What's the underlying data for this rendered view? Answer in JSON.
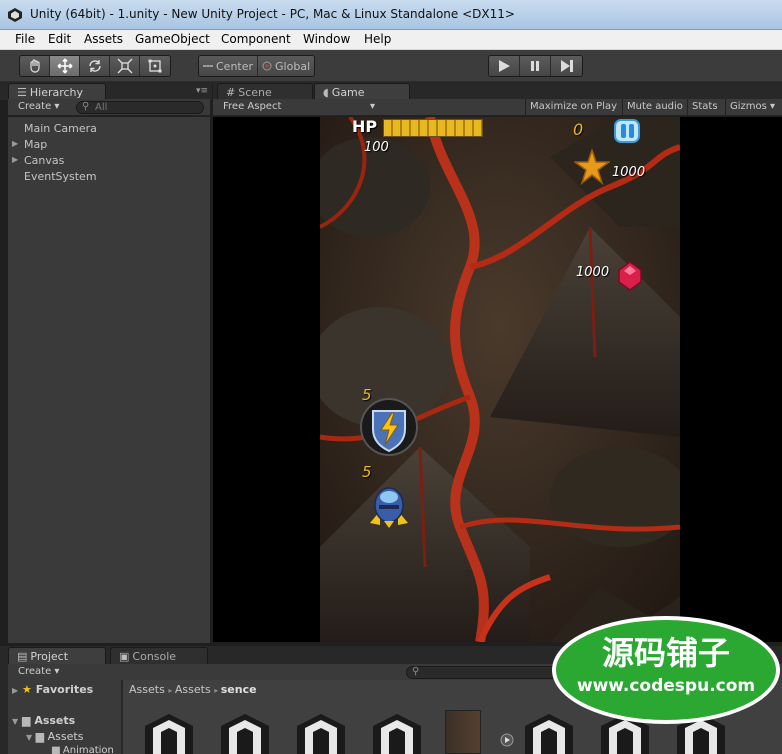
{
  "window": {
    "title": "Unity (64bit) - 1.unity - New Unity Project - PC, Mac & Linux Standalone <DX11>"
  },
  "menu": [
    "File",
    "Edit",
    "Assets",
    "GameObject",
    "Component",
    "Window",
    "Help"
  ],
  "toolbar": {
    "tools": [
      "hand-icon",
      "move-icon",
      "rotate-icon",
      "scale-icon",
      "rect-icon"
    ],
    "pivot_center": "Center",
    "pivot_global": "Global",
    "playback": [
      "play-icon",
      "pause-icon",
      "step-icon"
    ]
  },
  "hierarchy": {
    "tab_label": "Hierarchy",
    "create_label": "Create",
    "search_placeholder": "All",
    "items": [
      {
        "label": "Main Camera",
        "expandable": false
      },
      {
        "label": "Map",
        "expandable": true
      },
      {
        "label": "Canvas",
        "expandable": true
      },
      {
        "label": "EventSystem",
        "expandable": false
      }
    ]
  },
  "scene_tab": {
    "label": "Scene"
  },
  "game_tab": {
    "label": "Game",
    "aspect": "Free Aspect",
    "buttons": [
      "Maximize on Play",
      "Mute audio",
      "Stats",
      "Gizmos"
    ]
  },
  "game_hud": {
    "hp_label": "HP",
    "hp_value": "100",
    "hp_fraction": 1.0,
    "score": "0",
    "star_points": "1000",
    "gem_points": "1000",
    "shield_count": "5",
    "player_count": "5",
    "pause_icon": "pause-icon"
  },
  "project_tab": {
    "label": "Project",
    "create_label": "Create"
  },
  "console_tab": {
    "label": "Console"
  },
  "favorites": {
    "label": "Favorites",
    "assets_label": "Assets",
    "subfolder": "Assets",
    "sub_subfolder": "Animation"
  },
  "breadcrumb": [
    "Assets",
    "Assets",
    "sence"
  ],
  "watermark": {
    "title": "源码铺子",
    "url": "www.codespu.com"
  },
  "colors": {
    "unity_dark": "#3a3a3a",
    "lava_red": "#c8321a",
    "hp_yellow": "#e8b820",
    "watermark_green": "#2aa832"
  }
}
